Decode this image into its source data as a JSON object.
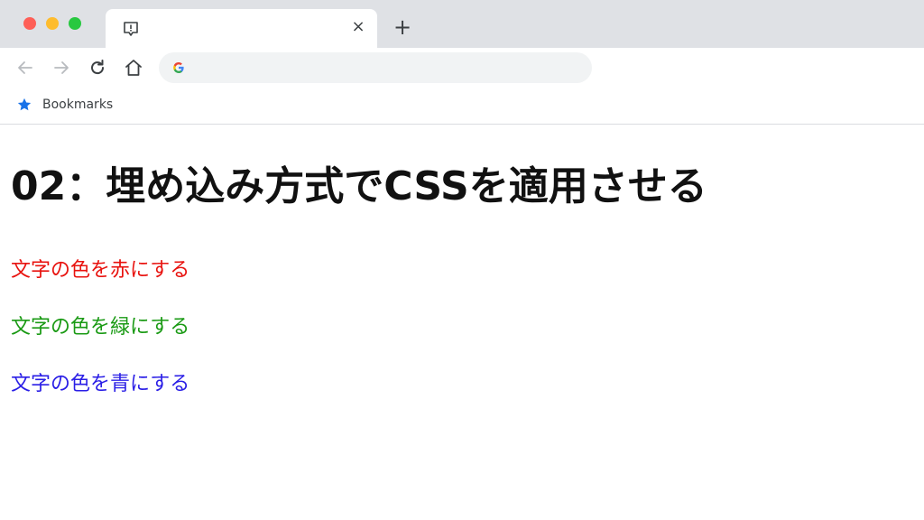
{
  "browser": {
    "tab": {
      "close_glyph": "×",
      "favicon": "page-alert-icon"
    },
    "new_tab_glyph": "+",
    "toolbar": {
      "back_icon": "arrow-left-icon",
      "forward_icon": "arrow-right-icon",
      "reload_icon": "reload-icon",
      "home_icon": "home-icon",
      "address_value": ""
    },
    "bookmarks": {
      "label": "Bookmarks",
      "icon": "star-icon",
      "icon_color": "#1a73e8"
    }
  },
  "page": {
    "title": "02：埋め込み方式でCSSを適用させる",
    "paragraphs": [
      {
        "text": "文字の色を赤にする",
        "color": "#e8130f"
      },
      {
        "text": "文字の色を緑にする",
        "color": "#1a9a14"
      },
      {
        "text": "文字の色を青にする",
        "color": "#2a1ee6"
      }
    ]
  }
}
